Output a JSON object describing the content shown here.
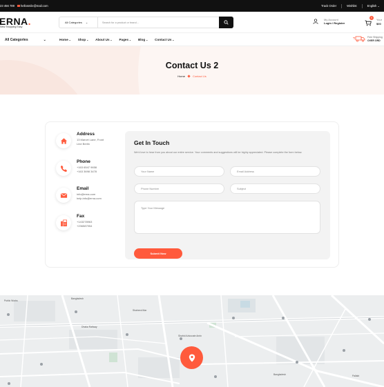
{
  "topbar": {
    "phone": "23 456 789",
    "email": "hellosmile@mail.com",
    "track_order": "Track Order",
    "wishlist": "Wishlist",
    "language": "English"
  },
  "header": {
    "logo": "ERNA",
    "logo_dot": ".",
    "tagline": "New Shopping Easy",
    "search": {
      "category": "All Categories",
      "placeholder": "Search for a product or brand..."
    },
    "account": {
      "label": "My Account",
      "action": "Login / Register"
    },
    "cart": {
      "count": "0",
      "label": "Your",
      "amount": "$00"
    }
  },
  "nav": {
    "all_categories": "All Categories",
    "items": [
      "Home",
      "Shop",
      "About Us",
      "Pages",
      "Blog",
      "Contact Us"
    ],
    "shipping_line1": "Free Shipping",
    "shipping_line2": "OVER ORD"
  },
  "hero": {
    "title": "Contact Us 2",
    "crumb_home": "Home",
    "crumb_current": "Contact Us"
  },
  "contact_info": [
    {
      "icon": "home-icon",
      "title": "Address",
      "lines": [
        "13 Marvel Lane, Front",
        "Line Berlin"
      ]
    },
    {
      "icon": "phone-icon",
      "title": "Phone",
      "lines": [
        "+163 6547 9658",
        "+163 3698 3478"
      ]
    },
    {
      "icon": "mail-icon",
      "title": "Email",
      "lines": [
        "info@erna.com",
        "help.info@erna.com"
      ]
    },
    {
      "icon": "fax-icon",
      "title": "Fax",
      "lines": [
        "+143278963",
        "+236587954"
      ]
    }
  ],
  "form": {
    "title": "Get In Touch",
    "description": "We'd love to hear from you about our entire service. Your comments and suggestions will be highly appreciated. Please complete the form below.",
    "name_placeholder": "Your Name",
    "email_placeholder": "Email Address",
    "phone_placeholder": "Phone Number",
    "subject_placeholder": "Subject",
    "message_placeholder": "Type Your Message",
    "submit_label": "Submit Now"
  },
  "map": {
    "labels": [
      "Public Works",
      "Bangladesh",
      "Shaheed Mar",
      "Dhaka Railway",
      "Shahid Advocate Amin",
      "Bangladesh",
      "Pallabi"
    ]
  },
  "colors": {
    "accent": "#ff5a3c",
    "dark": "#111111",
    "hero_bg": "#fbeee9"
  }
}
